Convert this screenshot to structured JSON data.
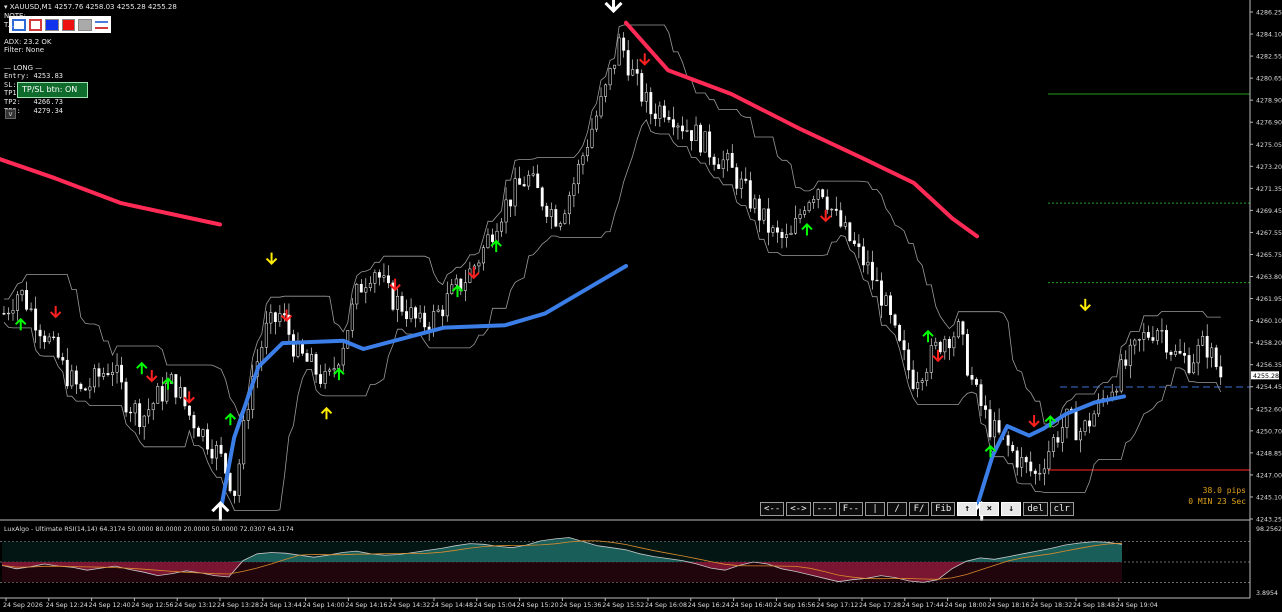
{
  "header": {
    "symbol_line": "XAUUSD,M1  4257.76 4258.03 4255.28 4255.28",
    "info_lines": [
      "NOTE: ...",
      "T...",
      "",
      "ADX: 23.2 OK",
      "Filter: None",
      "",
      "— LONG —",
      "Entry: 4253.83",
      "SL:    4247.45",
      "TP1:   4257.68",
      "TP2:   4266.73",
      "TP3:   4279.34"
    ],
    "overlay_button": "TP/SL btn: ON",
    "collapse_button": "v"
  },
  "swatches": [
    "#2e6bd6",
    "#d23b3b",
    "#1133ee",
    "#ee1111",
    "#aaaaaa",
    "#4a7bdc"
  ],
  "toolbar": [
    "<--",
    "<->",
    "---",
    "F--",
    "|",
    "/",
    "F/",
    "Fib",
    "↑",
    "×",
    "↓",
    "del",
    "clr"
  ],
  "countdown": {
    "pips": "38.0 pips",
    "time": "0 MIN 23 Sec"
  },
  "colors": {
    "background": "#000000",
    "bull": "#00ff00",
    "bear": "#ff2020",
    "ma_red": "#ff2a55",
    "ma_blue": "#3b7ee8",
    "signal_yellow": "#ffee00"
  },
  "chart_data": [
    {
      "type": "candlestick",
      "title": "XAUUSD,M1",
      "price_ticks": [
        "4286.25",
        "4284.10",
        "4282.55",
        "4280.65",
        "4278.90",
        "4276.90",
        "4275.05",
        "4273.20",
        "4271.35",
        "4269.45",
        "4267.55",
        "4265.75",
        "4263.80",
        "4261.95",
        "4260.10",
        "4258.20",
        "4256.35",
        "4254.45",
        "4252.60",
        "4250.70",
        "4248.85",
        "4247.00",
        "4245.10",
        "4243.25"
      ],
      "ylim": [
        4243.25,
        4286.25
      ],
      "current_price": "4255.28",
      "time_ticks": [
        "24 Sep 2026",
        "24 Sep 12:24",
        "24 Sep 12:40",
        "24 Sep 12:56",
        "24 Sep 13:12",
        "24 Sep 13:28",
        "24 Sep 13:44",
        "24 Sep 14:00",
        "24 Sep 14:16",
        "24 Sep 14:32",
        "24 Sep 14:48",
        "24 Sep 15:04",
        "24 Sep 15:20",
        "24 Sep 15:36",
        "24 Sep 15:52",
        "24 Sep 16:08",
        "24 Sep 16:24",
        "24 Sep 16:40",
        "24 Sep 16:56",
        "24 Sep 17:12",
        "24 Sep 17:28",
        "24 Sep 17:44",
        "24 Sep 18:00",
        "24 Sep 18:16",
        "24 Sep 18:32",
        "24 Sep 18:48",
        "24 Sep 19:04"
      ],
      "close_path": [
        4260.5,
        4262.5,
        4260.2,
        4258.0,
        4255.5,
        4253.8,
        4255.0,
        4256.2,
        4253.0,
        4251.8,
        4253.5,
        4254.8,
        4252.0,
        4250.3,
        4248.5,
        4245.5,
        4254.5,
        4259.0,
        4260.5,
        4257.2,
        4256.0,
        4254.5,
        4258.0,
        4262.5,
        4264.5,
        4262.0,
        4261.0,
        4259.5,
        4260.2,
        4262.0,
        4263.5,
        4265.5,
        4268.5,
        4270.5,
        4272.0,
        4270.0,
        4268.5,
        4271.5,
        4275.5,
        4279.0,
        4283.5,
        4280.0,
        4277.5,
        4278.0,
        4276.5,
        4275.5,
        4274.0,
        4273.0,
        4271.0,
        4269.0,
        4267.0,
        4266.5,
        4270.0,
        4271.5,
        4268.5,
        4266.5,
        4264.5,
        4262.0,
        4258.0,
        4255.0,
        4256.5,
        4258.5,
        4259.0,
        4254.0,
        4251.0,
        4249.5,
        4248.0,
        4246.8,
        4249.5,
        4251.5,
        4250.5,
        4252.5,
        4254.5,
        4256.5,
        4258.5,
        4259.5,
        4257.0,
        4256.5,
        4258.0,
        4255.3
      ],
      "red_ma_segments": [
        [
          [
            4273.5,
            0
          ],
          [
            4271.9,
            0.25
          ],
          [
            4269.8,
            0.55
          ],
          [
            4268.0,
            1.0
          ]
        ],
        [
          [
            4285.0,
            0
          ],
          [
            4281.0,
            0.12
          ],
          [
            4279.0,
            0.3
          ],
          [
            4276.0,
            0.5
          ],
          [
            4273.5,
            0.68
          ],
          [
            4271.5,
            0.82
          ],
          [
            4268.5,
            0.93
          ],
          [
            4267.0,
            1.0
          ]
        ]
      ],
      "blue_ma_segments": [
        [
          [
            4244.5,
            0
          ],
          [
            4250.0,
            0.03
          ],
          [
            4256.0,
            0.09
          ],
          [
            4258.0,
            0.15
          ],
          [
            4258.2,
            0.3
          ],
          [
            4257.5,
            0.35
          ],
          [
            4259.3,
            0.55
          ],
          [
            4259.5,
            0.7
          ],
          [
            4260.5,
            0.8
          ],
          [
            4262.5,
            0.9
          ],
          [
            4264.5,
            1.0
          ]
        ],
        [
          [
            4244.5,
            0
          ],
          [
            4248.5,
            0.1
          ],
          [
            4251.0,
            0.2
          ],
          [
            4250.2,
            0.35
          ],
          [
            4250.8,
            0.45
          ],
          [
            4252.0,
            0.6
          ],
          [
            4253.0,
            0.8
          ],
          [
            4253.5,
            1.0
          ]
        ]
      ],
      "tp_sl_levels": [
        {
          "name": "TP3",
          "price": 4279.0,
          "color": "#1f9d1f"
        },
        {
          "name": "TP2",
          "price": 4269.8,
          "color": "#1f9d1f"
        },
        {
          "name": "TP1",
          "price": 4263.1,
          "color": "#1f9d1f"
        },
        {
          "name": "Entry",
          "price": 4254.3,
          "color": "#3b6fd4"
        },
        {
          "name": "SL",
          "price": 4247.3,
          "color": "#d42020"
        }
      ],
      "signals": [
        {
          "kind": "up",
          "color": "green",
          "t": 0.015,
          "price": 4260.0
        },
        {
          "kind": "down",
          "color": "red",
          "t": 0.043,
          "price": 4260.2
        },
        {
          "kind": "up",
          "color": "green",
          "t": 0.112,
          "price": 4256.3
        },
        {
          "kind": "down",
          "color": "red",
          "t": 0.12,
          "price": 4254.8
        },
        {
          "kind": "up",
          "color": "green",
          "t": 0.133,
          "price": 4255.0
        },
        {
          "kind": "down",
          "color": "red",
          "t": 0.15,
          "price": 4253.0
        },
        {
          "kind": "up",
          "color": "green",
          "t": 0.183,
          "price": 4252.0
        },
        {
          "kind": "down",
          "color": "yellow",
          "t": 0.216,
          "price": 4264.7
        },
        {
          "kind": "down",
          "color": "red",
          "t": 0.228,
          "price": 4259.9
        },
        {
          "kind": "up",
          "color": "yellow",
          "t": 0.26,
          "price": 4252.5
        },
        {
          "kind": "up",
          "color": "green",
          "t": 0.27,
          "price": 4255.8
        },
        {
          "kind": "down",
          "color": "red",
          "t": 0.315,
          "price": 4262.5
        },
        {
          "kind": "up",
          "color": "green",
          "t": 0.365,
          "price": 4262.8
        },
        {
          "kind": "down",
          "color": "red",
          "t": 0.378,
          "price": 4263.5
        },
        {
          "kind": "up",
          "color": "green",
          "t": 0.396,
          "price": 4266.6
        },
        {
          "kind": "down",
          "color": "white",
          "t": 0.49,
          "price": 4286.0
        },
        {
          "kind": "down",
          "color": "red",
          "t": 0.515,
          "price": 4281.5
        },
        {
          "kind": "up",
          "color": "green",
          "t": 0.645,
          "price": 4268.0
        },
        {
          "kind": "down",
          "color": "red",
          "t": 0.66,
          "price": 4268.3
        },
        {
          "kind": "up",
          "color": "green",
          "t": 0.742,
          "price": 4259.0
        },
        {
          "kind": "down",
          "color": "red",
          "t": 0.75,
          "price": 4256.5
        },
        {
          "kind": "up",
          "color": "white",
          "t": 0.785,
          "price": 4244.5
        },
        {
          "kind": "up",
          "color": "green",
          "t": 0.792,
          "price": 4249.3
        },
        {
          "kind": "down",
          "color": "red",
          "t": 0.827,
          "price": 4251.0
        },
        {
          "kind": "up",
          "color": "green",
          "t": 0.84,
          "price": 4251.8
        },
        {
          "kind": "down",
          "color": "yellow",
          "t": 0.868,
          "price": 4260.8
        },
        {
          "kind": "up",
          "color": "white",
          "t": 0.175,
          "price": 4244.5
        }
      ]
    },
    {
      "type": "area",
      "title": "LuxAlgo - Ultimate RSI(14,14) 64.3174 50.0000 80.0000 20.0000 50.0000 72.0307 64.3174",
      "ylim": [
        0,
        100
      ],
      "right_ticks": [
        "98.2562",
        "3.8954"
      ],
      "levels": [
        80,
        50,
        20
      ],
      "rsi": [
        45,
        40,
        43,
        47,
        44,
        42,
        38,
        41,
        44,
        39,
        35,
        30,
        33,
        37,
        34,
        30,
        28,
        52,
        62,
        64,
        63,
        60,
        57,
        60,
        64,
        66,
        62,
        60,
        61,
        64,
        67,
        70,
        74,
        77,
        76,
        73,
        71,
        75,
        81,
        84,
        86,
        80,
        74,
        71,
        68,
        62,
        58,
        55,
        52,
        47,
        41,
        38,
        45,
        50,
        47,
        40,
        36,
        31,
        26,
        21,
        24,
        26,
        30,
        27,
        22,
        20,
        24,
        40,
        51,
        56,
        54,
        58,
        62,
        66,
        70,
        75,
        78,
        80,
        79,
        76
      ]
    }
  ]
}
